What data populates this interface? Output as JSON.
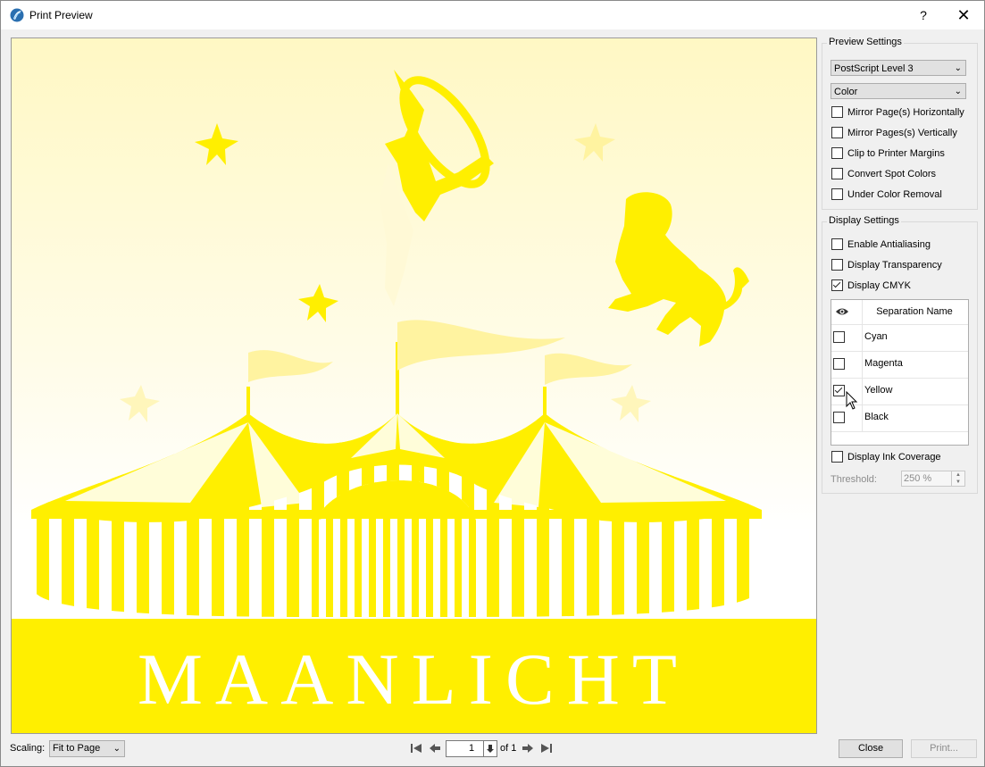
{
  "window": {
    "title": "Print Preview",
    "help_label": "?",
    "close_label": "✕"
  },
  "preview": {
    "banner_text": "MAANLICHT",
    "colors": {
      "yellow": "#ffef00",
      "pale": "#fff9cf",
      "background": "#ffffff"
    }
  },
  "preview_settings": {
    "group_label": "Preview Settings",
    "postscript_level": "PostScript Level 3",
    "color_mode": "Color",
    "options": [
      {
        "label": "Mirror Page(s) Horizontally",
        "checked": false
      },
      {
        "label": "Mirror Pages(s) Vertically",
        "checked": false
      },
      {
        "label": "Clip to Printer Margins",
        "checked": false
      },
      {
        "label": "Convert Spot Colors",
        "checked": false
      },
      {
        "label": "Under Color Removal",
        "checked": false
      }
    ]
  },
  "display_settings": {
    "group_label": "Display Settings",
    "options": [
      {
        "label": "Enable Antialiasing",
        "checked": false
      },
      {
        "label": "Display Transparency",
        "checked": false
      },
      {
        "label": "Display CMYK",
        "checked": true
      }
    ],
    "separations": {
      "header": "Separation Name",
      "eye_icon": "eye-icon",
      "rows": [
        {
          "name": "Cyan",
          "visible": false
        },
        {
          "name": "Magenta",
          "visible": false
        },
        {
          "name": "Yellow",
          "visible": true
        },
        {
          "name": "Black",
          "visible": false
        }
      ]
    },
    "ink_coverage": {
      "label": "Display Ink Coverage",
      "checked": false
    },
    "threshold": {
      "label": "Threshold:",
      "value": "250 %"
    }
  },
  "bottom_bar": {
    "scaling_label": "Scaling:",
    "scaling_value": "Fit to Page",
    "page_value": "1",
    "of_label": "of 1",
    "close_button": "Close",
    "print_button": "Print..."
  }
}
